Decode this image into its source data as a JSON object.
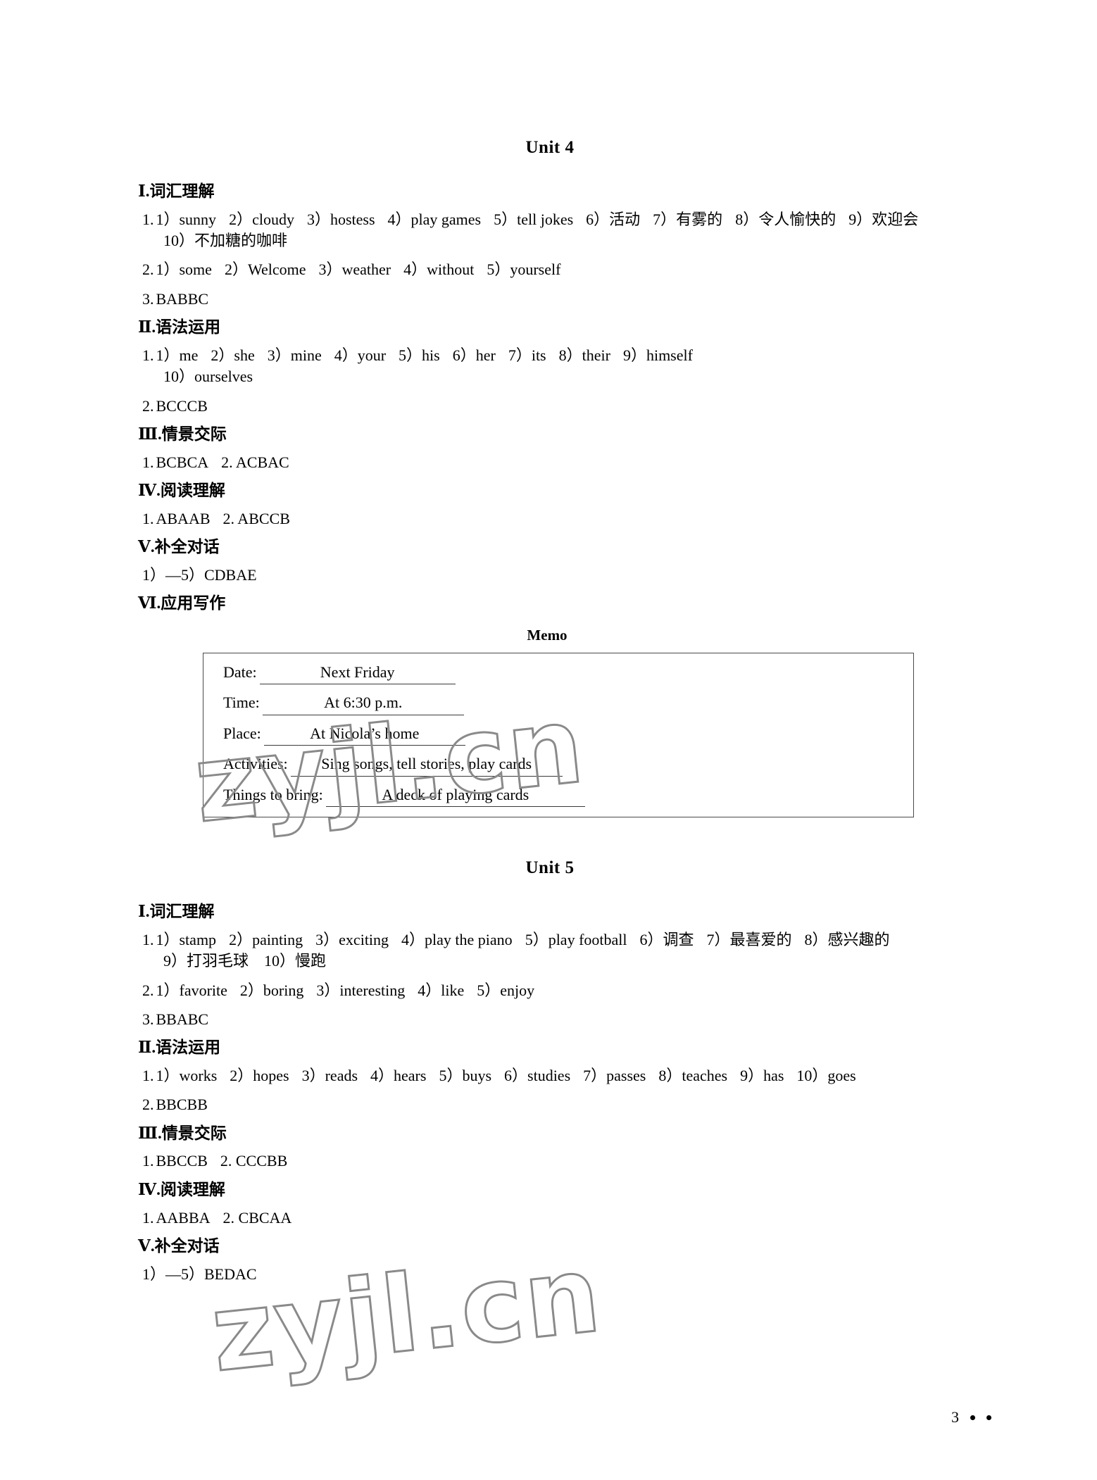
{
  "page": {
    "number": "3",
    "watermark": "zyjl.cn"
  },
  "units": [
    {
      "title": "Unit 4",
      "sections": [
        {
          "numeral": "Ⅰ",
          "heading": ".词汇理解",
          "lines": [
            {
              "label": "1.",
              "items": [
                "1）sunny",
                "2）cloudy",
                "3）hostess",
                "4）play games",
                "5）tell jokes",
                "6）活动",
                "7）有雾的",
                "8）令人愉快的",
                "9）欢迎会"
              ],
              "cont": "10）不加糖的咖啡"
            },
            {
              "label": "2.",
              "items": [
                "1）some",
                "2）Welcome",
                "3）weather",
                "4）without",
                "5）yourself"
              ],
              "cont": ""
            },
            {
              "label": "3.",
              "items": [
                "BABBC"
              ],
              "cont": ""
            }
          ]
        },
        {
          "numeral": "Ⅱ",
          "heading": ".语法运用",
          "lines": [
            {
              "label": "1.",
              "items": [
                "1）me",
                "2）she",
                "3）mine",
                "4）your",
                "5）his",
                "6）her",
                "7）its",
                "8）their",
                "9）himself"
              ],
              "cont": "10）ourselves"
            },
            {
              "label": "2.",
              "items": [
                "BCCCB"
              ],
              "cont": ""
            }
          ]
        },
        {
          "numeral": "Ⅲ",
          "heading": ".情景交际",
          "lines": [
            {
              "label": "1.",
              "items": [
                "BCBCA",
                "2. ACBAC"
              ],
              "cont": ""
            }
          ]
        },
        {
          "numeral": "Ⅳ",
          "heading": ".阅读理解",
          "lines": [
            {
              "label": "1.",
              "items": [
                "ABAAB",
                "2. ABCCB"
              ],
              "cont": ""
            }
          ]
        },
        {
          "numeral": "Ⅴ",
          "heading": ".补全对话",
          "lines": [
            {
              "label": "",
              "items": [
                "1）—5）CDBAE"
              ],
              "cont": ""
            }
          ]
        },
        {
          "numeral": "Ⅵ",
          "heading": ".应用写作",
          "lines": []
        }
      ]
    },
    {
      "title": "Unit 5",
      "sections": [
        {
          "numeral": "Ⅰ",
          "heading": ".词汇理解",
          "lines": [
            {
              "label": "1.",
              "items": [
                "1）stamp",
                "2）painting",
                "3）exciting",
                "4）play the piano",
                "5）play football",
                "6）调查",
                "7）最喜爱的",
                "8）感兴趣的"
              ],
              "cont": "9）打羽毛球　10）慢跑"
            },
            {
              "label": "2.",
              "items": [
                "1）favorite",
                "2）boring",
                "3）interesting",
                "4）like",
                "5）enjoy"
              ],
              "cont": ""
            },
            {
              "label": "3.",
              "items": [
                "BBABC"
              ],
              "cont": ""
            }
          ]
        },
        {
          "numeral": "Ⅱ",
          "heading": ".语法运用",
          "lines": [
            {
              "label": "1.",
              "items": [
                "1）works",
                "2）hopes",
                "3）reads",
                "4）hears",
                "5）buys",
                "6）studies",
                "7）passes",
                "8）teaches",
                "9）has",
                "10）goes"
              ],
              "cont": ""
            },
            {
              "label": "2.",
              "items": [
                "BBCBB"
              ],
              "cont": ""
            }
          ]
        },
        {
          "numeral": "Ⅲ",
          "heading": ".情景交际",
          "lines": [
            {
              "label": "1.",
              "items": [
                "BBCCB",
                "2. CCCBB"
              ],
              "cont": ""
            }
          ]
        },
        {
          "numeral": "Ⅳ",
          "heading": ".阅读理解",
          "lines": [
            {
              "label": "1.",
              "items": [
                "AABBA",
                "2. CBCAA"
              ],
              "cont": ""
            }
          ]
        },
        {
          "numeral": "Ⅴ",
          "heading": ".补全对话",
          "lines": [
            {
              "label": "",
              "items": [
                "1）—5）BEDAC"
              ],
              "cont": ""
            }
          ]
        }
      ]
    }
  ],
  "memo": {
    "title": "Memo",
    "rows": [
      {
        "label": "Date:",
        "value": "Next Friday"
      },
      {
        "label": "Time:",
        "value": "At 6:30 p.m."
      },
      {
        "label": "Place:",
        "value": "At Nicola’s home"
      },
      {
        "label": "Activities:",
        "value": "Sing songs, tell stories, play cards"
      },
      {
        "label": "Things to bring:",
        "value": "A deck of playing cards"
      }
    ]
  }
}
